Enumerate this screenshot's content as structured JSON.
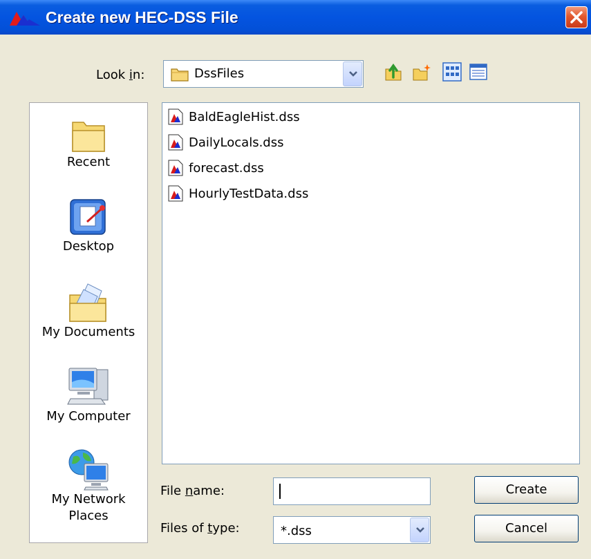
{
  "window": {
    "title": "Create new HEC-DSS File"
  },
  "look_in": {
    "label": "Look in:",
    "value": "DssFiles"
  },
  "toolbar": {
    "icons": [
      "up-one-level-icon",
      "new-folder-icon",
      "list-view-icon",
      "details-view-icon"
    ]
  },
  "places": [
    {
      "label": "Recent",
      "icon": "recent-folder-icon"
    },
    {
      "label": "Desktop",
      "icon": "desktop-icon"
    },
    {
      "label": "My Documents",
      "icon": "my-documents-icon"
    },
    {
      "label": "My Computer",
      "icon": "my-computer-icon"
    },
    {
      "label": "My Network\nPlaces",
      "icon": "network-places-icon"
    }
  ],
  "files": [
    {
      "name": "BaldEagleHist.dss",
      "icon": "dss-file-icon"
    },
    {
      "name": "DailyLocals.dss",
      "icon": "dss-file-icon"
    },
    {
      "name": "forecast.dss",
      "icon": "dss-file-icon"
    },
    {
      "name": "HourlyTestData.dss",
      "icon": "dss-file-icon"
    }
  ],
  "file_name": {
    "label": "File name:",
    "value": ""
  },
  "file_type": {
    "label": "Files of type:",
    "value": "*.dss"
  },
  "buttons": {
    "create": "Create",
    "cancel": "Cancel"
  },
  "colors": {
    "titlebar": "#0454e0",
    "dialog_bg": "#ece9d8",
    "close_button": "#e2592e",
    "dss_icon_red": "#d81b1b",
    "dss_icon_blue": "#1a2fd0"
  }
}
